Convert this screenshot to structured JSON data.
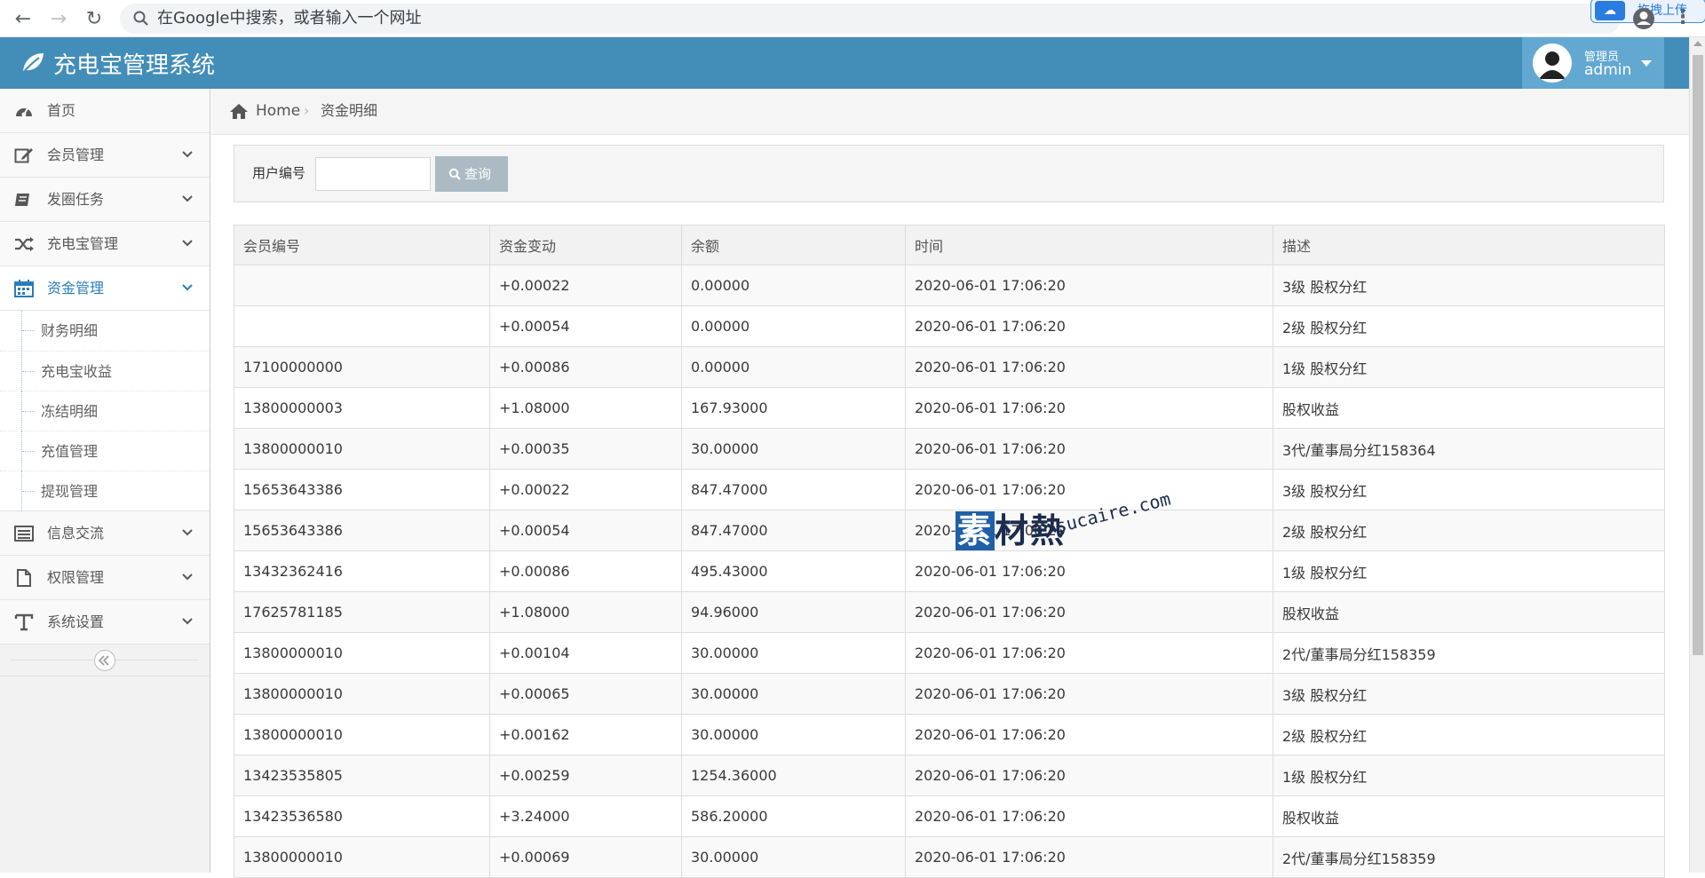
{
  "browser": {
    "url_placeholder": "在Google中搜索，或者输入一个网址",
    "upload_label": "拖拽上传"
  },
  "header": {
    "title": "充电宝管理系统",
    "user_role": "管理员",
    "user_name": "admin"
  },
  "sidebar": {
    "items": [
      {
        "label": "首页",
        "icon": "dashboard-icon"
      },
      {
        "label": "会员管理",
        "icon": "edit-icon"
      },
      {
        "label": "发圈任务",
        "icon": "book-icon"
      },
      {
        "label": "充电宝管理",
        "icon": "shuffle-icon"
      },
      {
        "label": "资金管理",
        "icon": "calendar-icon"
      },
      {
        "label": "信息交流",
        "icon": "list-icon"
      },
      {
        "label": "权限管理",
        "icon": "file-icon"
      },
      {
        "label": "系统设置",
        "icon": "text-icon"
      }
    ],
    "submenu": [
      "财务明细",
      "充电宝收益",
      "冻结明细",
      "充值管理",
      "提现管理"
    ]
  },
  "breadcrumb": {
    "home": "Home",
    "current": "资金明细"
  },
  "search": {
    "label": "用户编号",
    "value": "",
    "button": "查询"
  },
  "table": {
    "headers": [
      "会员编号",
      "资金变动",
      "余额",
      "时间",
      "描述"
    ],
    "rows": [
      [
        "",
        "+0.00022",
        "0.00000",
        "2020-06-01 17:06:20",
        "3级 股权分红"
      ],
      [
        "",
        "+0.00054",
        "0.00000",
        "2020-06-01 17:06:20",
        "2级 股权分红"
      ],
      [
        "17100000000",
        "+0.00086",
        "0.00000",
        "2020-06-01 17:06:20",
        "1级 股权分红"
      ],
      [
        "13800000003",
        "+1.08000",
        "167.93000",
        "2020-06-01 17:06:20",
        "股权收益"
      ],
      [
        "13800000010",
        "+0.00035",
        "30.00000",
        "2020-06-01 17:06:20",
        "3代/董事局分红158364"
      ],
      [
        "15653643386",
        "+0.00022",
        "847.47000",
        "2020-06-01 17:06:20",
        "3级 股权分红"
      ],
      [
        "15653643386",
        "+0.00054",
        "847.47000",
        "2020-06-01 17:06:20",
        "2级 股权分红"
      ],
      [
        "13432362416",
        "+0.00086",
        "495.43000",
        "2020-06-01 17:06:20",
        "1级 股权分红"
      ],
      [
        "17625781185",
        "+1.08000",
        "94.96000",
        "2020-06-01 17:06:20",
        "股权收益"
      ],
      [
        "13800000010",
        "+0.00104",
        "30.00000",
        "2020-06-01 17:06:20",
        "2代/董事局分红158359"
      ],
      [
        "13800000010",
        "+0.00065",
        "30.00000",
        "2020-06-01 17:06:20",
        "3级 股权分红"
      ],
      [
        "13800000010",
        "+0.00162",
        "30.00000",
        "2020-06-01 17:06:20",
        "2级 股权分红"
      ],
      [
        "13423535805",
        "+0.00259",
        "1254.36000",
        "2020-06-01 17:06:20",
        "1级 股权分红"
      ],
      [
        "13423536580",
        "+3.24000",
        "586.20000",
        "2020-06-01 17:06:20",
        "股权收益"
      ],
      [
        "13800000010",
        "+0.00069",
        "30.00000",
        "2020-06-01 17:06:20",
        "2代/董事局分红158359"
      ]
    ]
  },
  "watermark": {
    "cn": "素材熱",
    "en": "sucaire.com"
  },
  "colors": {
    "header": "#438eb9",
    "user_box": "#62a8d1",
    "active": "#2b7dbc",
    "button": "#abbac3"
  }
}
